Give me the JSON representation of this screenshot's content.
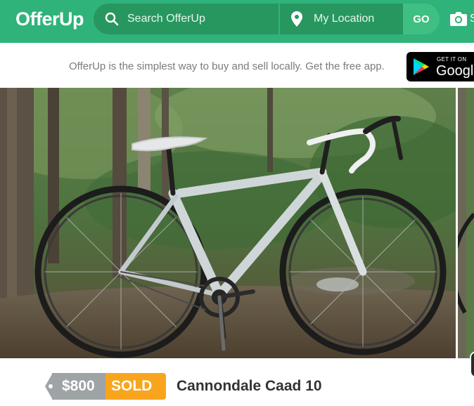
{
  "header": {
    "logo": "OfferUp",
    "search_placeholder": "Search OfferUp",
    "location_label": "My Location",
    "go_label": "GO",
    "sell_peek": "S"
  },
  "promo": {
    "text": "OfferUp is the simplest way to buy and sell locally. Get the free app.",
    "badge_top": "GET IT ON",
    "badge_main": "Google"
  },
  "listing": {
    "price": "$800",
    "status": "SOLD",
    "title": "Cannondale Caad 10"
  },
  "colors": {
    "brand_green": "#2fb37a",
    "search_green": "#27975f",
    "price_gray": "#9ea3a6",
    "sold_orange": "#f8a51d"
  },
  "icons": {
    "search": "search-icon",
    "location": "map-pin-icon",
    "camera": "camera-icon",
    "store": "google-play-icon"
  }
}
